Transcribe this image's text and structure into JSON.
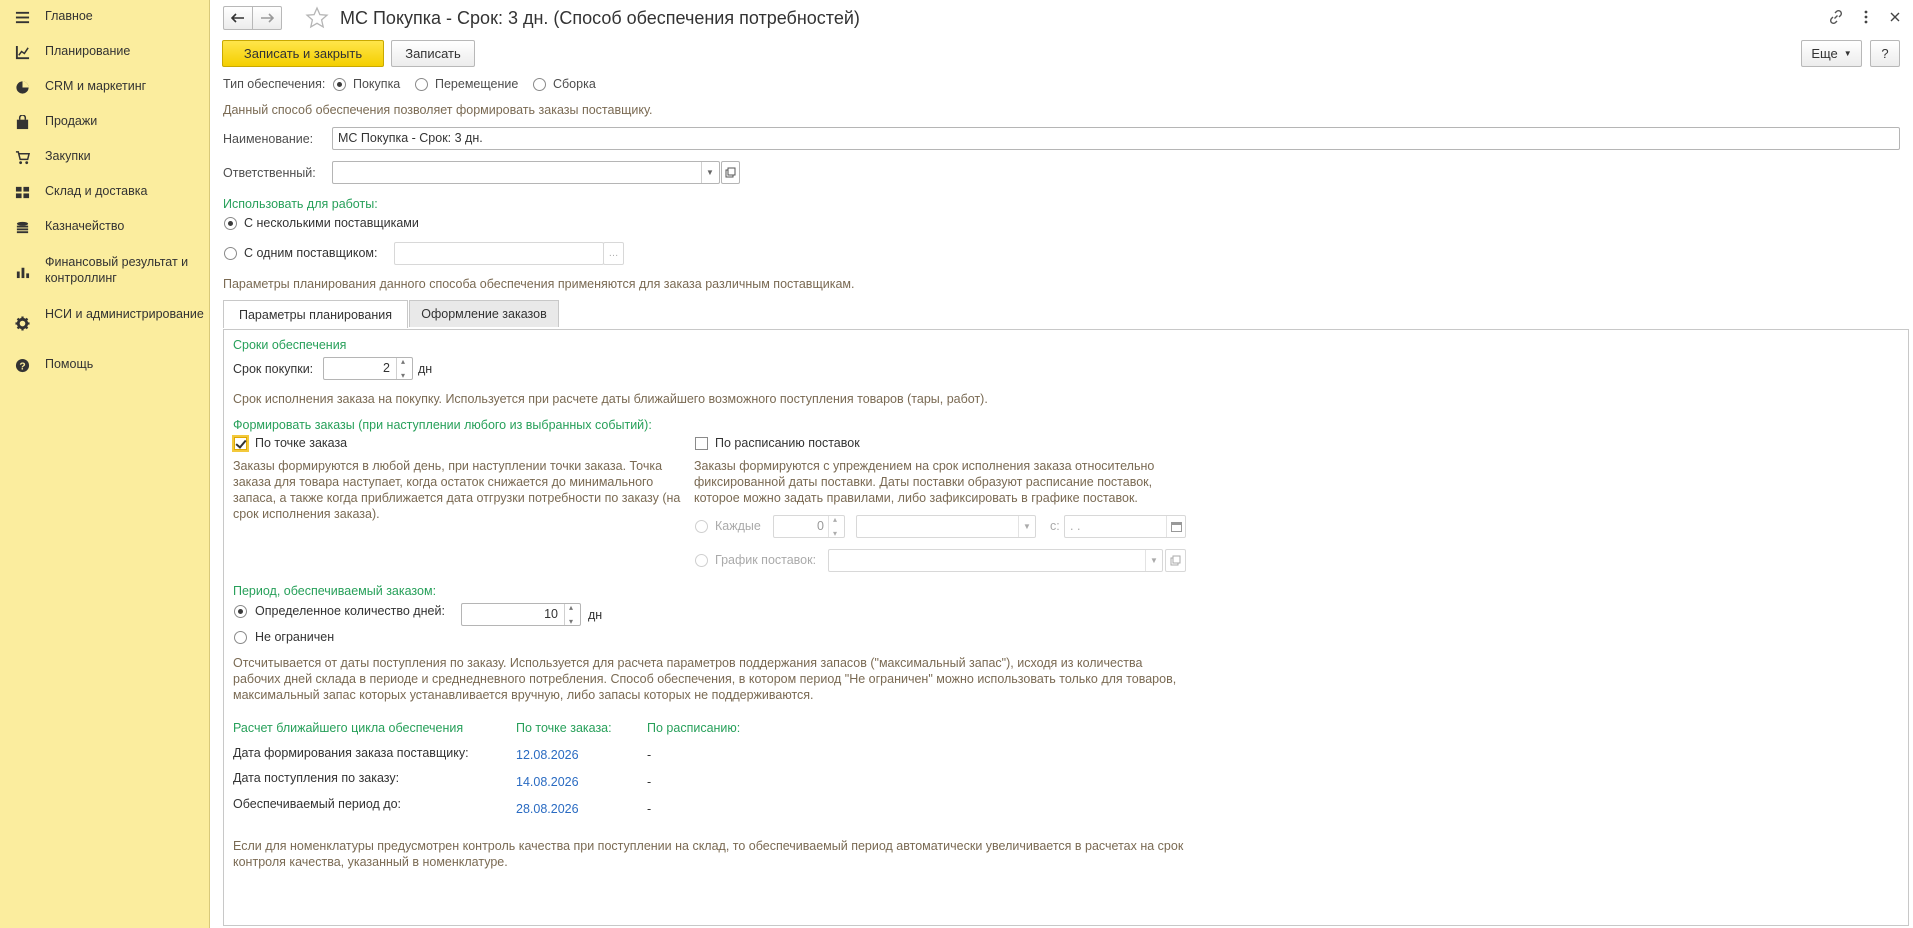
{
  "sidebar": {
    "items": [
      {
        "label": "Главное",
        "icon": "menu-icon"
      },
      {
        "label": "Планирование",
        "icon": "planning-icon"
      },
      {
        "label": "CRM и маркетинг",
        "icon": "pie-chart-icon"
      },
      {
        "label": "Продажи",
        "icon": "bag-icon"
      },
      {
        "label": "Закупки",
        "icon": "cart-icon"
      },
      {
        "label": "Склад и доставка",
        "icon": "warehouse-icon"
      },
      {
        "label": "Казначейство",
        "icon": "coins-icon"
      },
      {
        "label": "Финансовый результат и контроллинг",
        "icon": "bar-chart-icon"
      },
      {
        "label": "НСИ и администрирование",
        "icon": "gear-icon"
      },
      {
        "label": "Помощь",
        "icon": "help-icon"
      }
    ]
  },
  "header": {
    "title": "МС Покупка - Срок: 3 дн. (Способ обеспечения потребностей)",
    "save_close": "Записать и закрыть",
    "save": "Записать",
    "more": "Еще",
    "help": "?"
  },
  "supply_type": {
    "label": "Тип обеспечения:",
    "options": [
      "Покупка",
      "Перемещение",
      "Сборка"
    ],
    "selected": "Покупка",
    "note": "Данный способ обеспечения позволяет формировать заказы поставщику."
  },
  "name_field": {
    "label": "Наименование:",
    "value": "МС Покупка - Срок: 3 дн."
  },
  "responsible_field": {
    "label": "Ответственный:",
    "value": ""
  },
  "use_for_work": {
    "label": "Использовать для работы:",
    "option_many": "С несколькими поставщиками",
    "option_one": "С одним поставщиком:",
    "supplier_value": "",
    "note": "Параметры планирования данного способа обеспечения применяются для заказа различным поставщикам."
  },
  "tabs": [
    {
      "label": "Параметры планирования",
      "active": true
    },
    {
      "label": "Оформление заказов",
      "active": false
    }
  ],
  "planning": {
    "supply_terms_heading": "Сроки обеспечения",
    "purchase_term_label": "Срок покупки:",
    "purchase_term_value": "2",
    "days_unit": "дн",
    "purchase_term_note": "Срок исполнения заказа на покупку. Используется при расчете даты ближайшего возможного поступления товаров (тары, работ).",
    "form_orders_heading": "Формировать заказы (при наступлении любого из выбранных событий):",
    "by_order_point": {
      "label": "По точке заказа",
      "checked": true,
      "note": "Заказы формируются в любой день, при наступлении точки заказа. Точка заказа для товара наступает, когда остаток снижается до минимального запаса, а также когда приближается дата отгрузки потребности по заказу (на срок исполнения заказа)."
    },
    "by_schedule": {
      "label": "По расписанию поставок",
      "checked": false,
      "note": "Заказы формируются с упреждением на срок исполнения заказа относительно фиксированной даты поставки. Даты поставки образуют расписание поставок, которое можно задать правилами, либо зафиксировать в графике поставок.",
      "every_label": "Каждые",
      "every_value": "0",
      "period_value": "",
      "from_label": "с:",
      "from_value": " .  .",
      "schedule_label": "График поставок:",
      "schedule_value": ""
    },
    "period_heading": "Период, обеспечиваемый заказом:",
    "period_fixed_label": "Определенное количество дней:",
    "period_fixed_value": "10",
    "period_unlimited_label": "Не ограничен",
    "period_note": "Отсчитывается от даты поступления по заказу. Используется для расчета параметров поддержания запасов (\"максимальный запас\"), исходя из количества рабочих дней склада в периоде и среднедневного потребления. Способ обеспечения, в котором период \"Не ограничен\" можно использовать только для товаров, максимальный запас которых устанавливается вручную, либо запасы которых не поддерживаются.",
    "cycle": {
      "heading": "Расчет ближайшего цикла обеспечения",
      "col_point": "По точке заказа:",
      "col_schedule": "По расписанию:",
      "rows": [
        {
          "label": "Дата формирования заказа поставщику:",
          "point": "12.08.2026",
          "schedule": "-"
        },
        {
          "label": "Дата поступления по заказу:",
          "point": "14.08.2026",
          "schedule": "-"
        },
        {
          "label": "Обеспечиваемый период до:",
          "point": "28.08.2026",
          "schedule": "-"
        }
      ]
    },
    "quality_note": "Если для номенклатуры предусмотрен контроль качества при поступлении на склад, то обеспечиваемый период автоматически увеличивается в расчетах на срок контроля качества, указанный в номенклатуре."
  }
}
